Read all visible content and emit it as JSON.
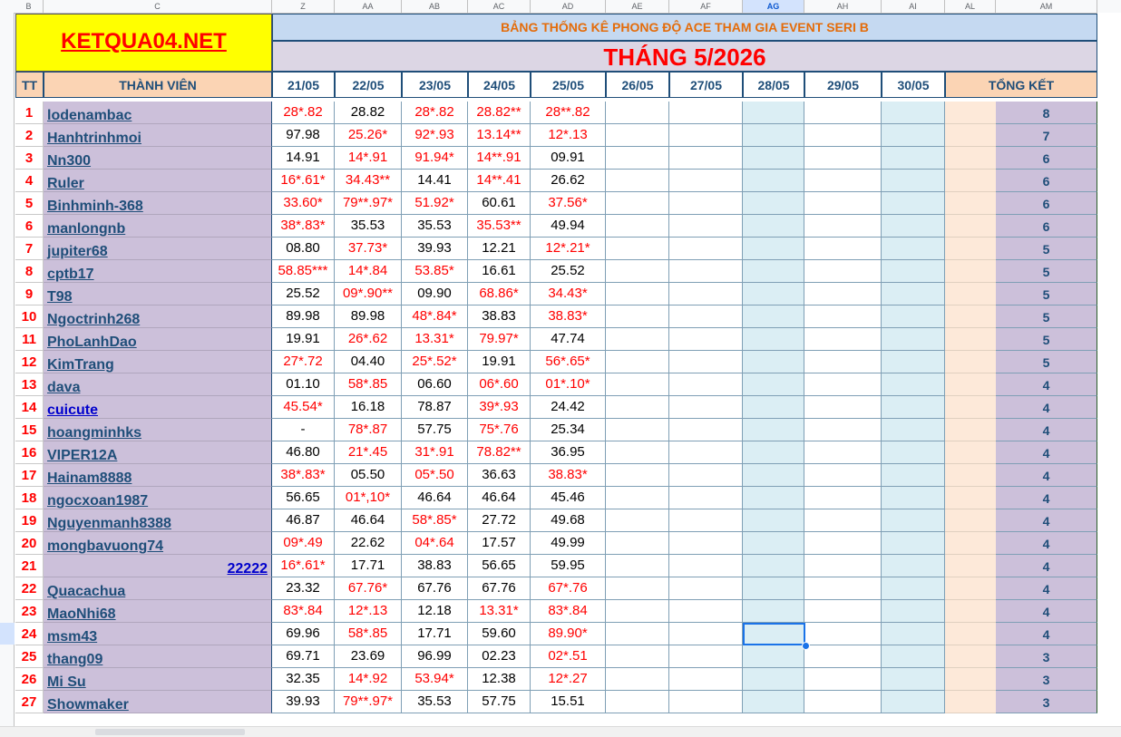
{
  "column_headers": [
    "B",
    "C",
    "Z",
    "AA",
    "AB",
    "AC",
    "AD",
    "AE",
    "AF",
    "AG",
    "AH",
    "AI",
    "AL",
    "AM"
  ],
  "selected_column": "AG",
  "logo_text": "KETQUA04.NET",
  "title": "BẢNG THỐNG KÊ PHONG ĐỘ ACE THAM GIA EVENT SERI B",
  "month": "THÁNG 5/2026",
  "header": {
    "tt": "TT",
    "member": "THÀNH VIÊN",
    "dates": [
      "21/05",
      "22/05",
      "23/05",
      "24/05",
      "25/05",
      "26/05",
      "27/05",
      "28/05",
      "29/05",
      "30/05"
    ],
    "total": "TỔNG KẾT"
  },
  "rows": [
    {
      "tt": "1",
      "name": "lodenambac",
      "v": [
        "28*.82",
        "28.82",
        "28*.82",
        "28.82**",
        "28**.82"
      ],
      "total": "8"
    },
    {
      "tt": "2",
      "name": "Hanhtrinhmoi",
      "v": [
        "97.98",
        "25.26*",
        "92*.93",
        "13.14**",
        "12*.13"
      ],
      "total": "7"
    },
    {
      "tt": "3",
      "name": "Nn300",
      "v": [
        "14.91",
        "14*.91",
        "91.94*",
        "14**.91",
        "09.91"
      ],
      "total": "6"
    },
    {
      "tt": "4",
      "name": "Ruler",
      "v": [
        "16*.61*",
        "34.43**",
        "14.41",
        "14**.41",
        "26.62"
      ],
      "total": "6"
    },
    {
      "tt": "5",
      "name": "Binhminh-368",
      "v": [
        "33.60*",
        "79**.97*",
        "51.92*",
        "60.61",
        "37.56*"
      ],
      "total": "6"
    },
    {
      "tt": "6",
      "name": "manlongnb",
      "v": [
        "38*.83*",
        "35.53",
        "35.53",
        "35.53**",
        "49.94"
      ],
      "total": "6"
    },
    {
      "tt": "7",
      "name": "jupiter68",
      "v": [
        "08.80",
        "37.73*",
        "39.93",
        "12.21",
        "12*.21*"
      ],
      "total": "5"
    },
    {
      "tt": "8",
      "name": "cptb17",
      "v": [
        "58.85***",
        "14*.84",
        "53.85*",
        "16.61",
        "25.52"
      ],
      "total": "5"
    },
    {
      "tt": "9",
      "name": "T98",
      "v": [
        "25.52",
        "09*.90**",
        "09.90",
        "68.86*",
        "34.43*"
      ],
      "total": "5"
    },
    {
      "tt": "10",
      "name": "Ngoctrinh268",
      "v": [
        "89.98",
        "89.98",
        "48*.84*",
        "38.83",
        "38.83*"
      ],
      "total": "5"
    },
    {
      "tt": "11",
      "name": "PhoLanhDao",
      "v": [
        "19.91",
        "26*.62",
        "13.31*",
        "79.97*",
        "47.74"
      ],
      "total": "5"
    },
    {
      "tt": "12",
      "name": "KimTrang",
      "v": [
        "27*.72",
        "04.40",
        "25*.52*",
        "19.91",
        "56*.65*"
      ],
      "total": "5"
    },
    {
      "tt": "13",
      "name": "dava",
      "v": [
        "01.10",
        "58*.85",
        "06.60",
        "06*.60",
        "01*.10*"
      ],
      "total": "4"
    },
    {
      "tt": "14",
      "name": "cuicute",
      "v": [
        "45.54*",
        "16.18",
        "78.87",
        "39*.93",
        "24.42"
      ],
      "total": "4"
    },
    {
      "tt": "15",
      "name": "hoangminhks",
      "v": [
        "-",
        "78*.87",
        "57.75",
        "75*.76",
        "25.34"
      ],
      "total": "4"
    },
    {
      "tt": "16",
      "name": "VIPER12A",
      "v": [
        "46.80",
        "21*.45",
        "31*.91",
        "78.82**",
        "36.95"
      ],
      "total": "4"
    },
    {
      "tt": "17",
      "name": "Hainam8888",
      "v": [
        "38*.83*",
        "05.50",
        "05*.50",
        "36.63",
        "38.83*"
      ],
      "total": "4"
    },
    {
      "tt": "18",
      "name": "ngocxoan1987",
      "v": [
        "56.65",
        "01*,10*",
        "46.64",
        "46.64",
        "45.46"
      ],
      "total": "4"
    },
    {
      "tt": "19",
      "name": "Nguyenmanh8388",
      "v": [
        "46.87",
        "46.64",
        "58*.85*",
        "27.72",
        "49.68"
      ],
      "total": "4"
    },
    {
      "tt": "20",
      "name": "mongbavuong74",
      "v": [
        "09*.49",
        "22.62",
        "04*.64",
        "17.57",
        "49.99"
      ],
      "total": "4"
    },
    {
      "tt": "21",
      "name": "22222",
      "v": [
        "16*.61*",
        "17.71",
        "38.83",
        "56.65",
        "59.95"
      ],
      "total": "4"
    },
    {
      "tt": "22",
      "name": "Quacachua",
      "v": [
        "23.32",
        "67.76*",
        "67.76",
        "67.76",
        "67*.76"
      ],
      "total": "4"
    },
    {
      "tt": "23",
      "name": "MaoNhi68",
      "v": [
        "83*.84",
        "12*.13",
        "12.18",
        "13.31*",
        "83*.84"
      ],
      "total": "4"
    },
    {
      "tt": "24",
      "name": "msm43",
      "v": [
        "69.96",
        "58*.85",
        "17.71",
        "59.60",
        "89.90*"
      ],
      "total": "4"
    },
    {
      "tt": "25",
      "name": "thang09",
      "v": [
        "69.71",
        "23.69",
        "96.99",
        "02.23",
        "02*.51"
      ],
      "total": "3"
    },
    {
      "tt": "26",
      "name": "Mi Su",
      "v": [
        "32.35",
        "14*.92",
        "53.94*",
        "12.38",
        "12*.27"
      ],
      "total": "3"
    },
    {
      "tt": "27",
      "name": "Showmaker",
      "v": [
        "39.93",
        "79**.97*",
        "35.53",
        "57.75",
        "15.51"
      ],
      "total": "3"
    }
  ],
  "colors": {
    "red": "#ff0000",
    "navy": "#1f4e79",
    "logo_bg": "#ffff00",
    "purple": "#ccc0da",
    "blue_col": "#dbeef4",
    "peach": "#fde9d9"
  }
}
